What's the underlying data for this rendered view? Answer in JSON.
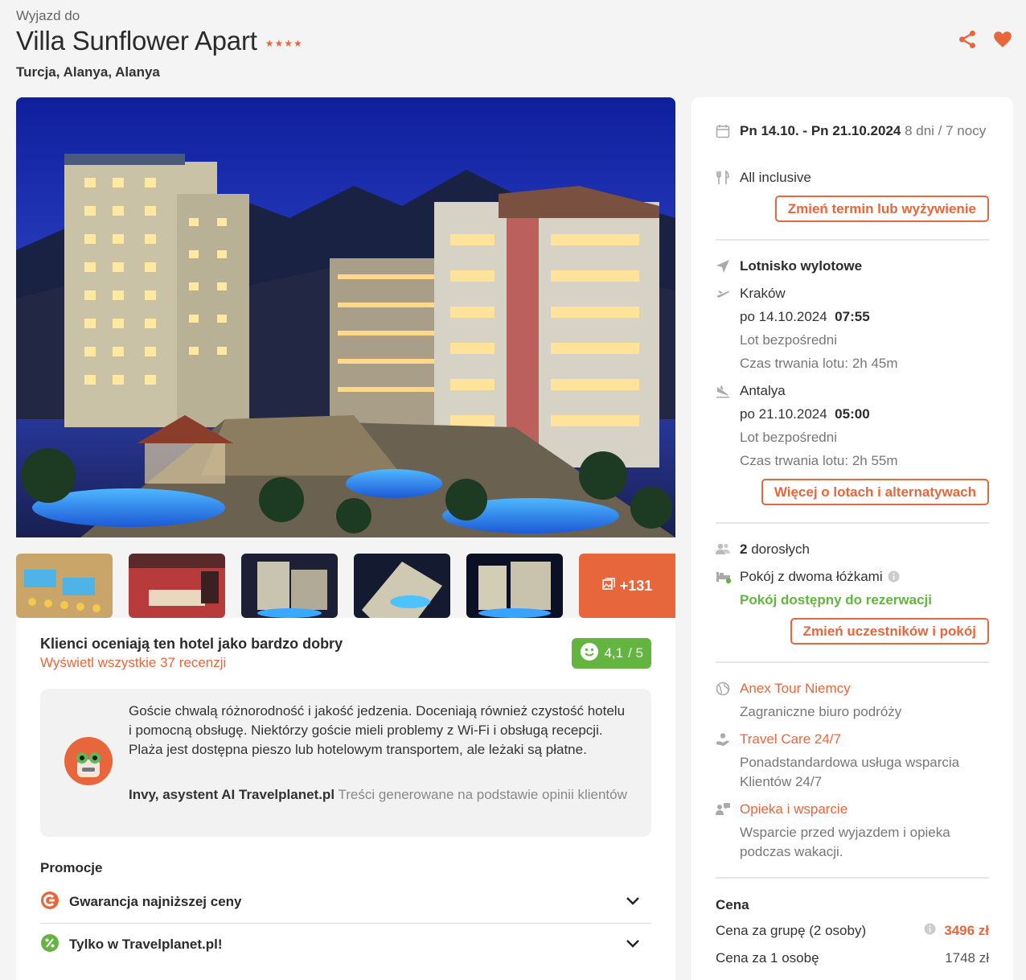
{
  "header": {
    "eyebrow": "Wyjazd do",
    "title": "Villa Sunflower Apart",
    "stars": "★★★★",
    "location": "Turcja, Alanya, Alanya"
  },
  "gallery": {
    "more_count": "+131"
  },
  "rating": {
    "title": "Klienci oceniają ten hotel jako bardzo dobry",
    "link": "Wyświetl wszystkie 37 recenzji",
    "score": "4,1",
    "scale": " / 5"
  },
  "ai_summary": {
    "text": "Goście chwalą różnorodność i jakość jedzenia. Doceniają również czystość hotelu i pomocną obsługę. Niektórzy goście mieli problemy z Wi-Fi i obsługą recepcji. Plaża jest dostępna pieszo lub hotelowym transportem, ale leżaki są płatne.",
    "author": "Invy, asystent AI Travelplanet.pl",
    "note": " Treści generowane na podstawie opinii klientów"
  },
  "promotions": {
    "label": "Promocje",
    "items": [
      {
        "label": "Gwarancja najniższej ceny"
      },
      {
        "label": "Tylko w Travelplanet.pl!"
      }
    ]
  },
  "booking": {
    "dates": "Pn 14.10. - Pn 21.10.2024",
    "duration": " 8 dni / 7 nocy",
    "board": "All inclusive",
    "change_term_button": "Zmień termin lub wyżywienie",
    "airport_label": "Lotnisko wylotowe",
    "outbound": {
      "city": "Kraków",
      "date": "po 14.10.2024",
      "time": "07:55",
      "type": "Lot bezpośredni",
      "duration": "Czas trwania lotu: 2h 45m"
    },
    "inbound": {
      "city": "Antalya",
      "date": "po 21.10.2024",
      "time": "05:00",
      "type": "Lot bezpośredni",
      "duration": "Czas trwania lotu: 2h 55m"
    },
    "flights_button": "Więcej o lotach i alternatywach",
    "adults_count": "2",
    "adults_label": " dorosłych",
    "room": "Pokój z dwoma łóżkami",
    "room_status": "Pokój dostępny do rezerwacji",
    "change_participants_button": "Zmień uczestników i pokój",
    "operator": "Anex Tour Niemcy",
    "operator_desc": "Zagraniczne biuro podróży",
    "care": "Travel Care 24/7",
    "care_desc": "Ponadstandardowa usługa wsparcia Klientów 24/7",
    "support": "Opieka i wsparcie",
    "support_desc": "Wsparcie przed wyjazdem i opieka podczas wakacji.",
    "price_label": "Cena",
    "group_price_label": "Cena za grupę (2 osoby)",
    "group_price": "3496 zł",
    "person_price_label": "Cena za 1 osobę",
    "person_price": "1748 zł"
  },
  "colors": {
    "accent": "#e8663b",
    "success": "#63b540"
  }
}
